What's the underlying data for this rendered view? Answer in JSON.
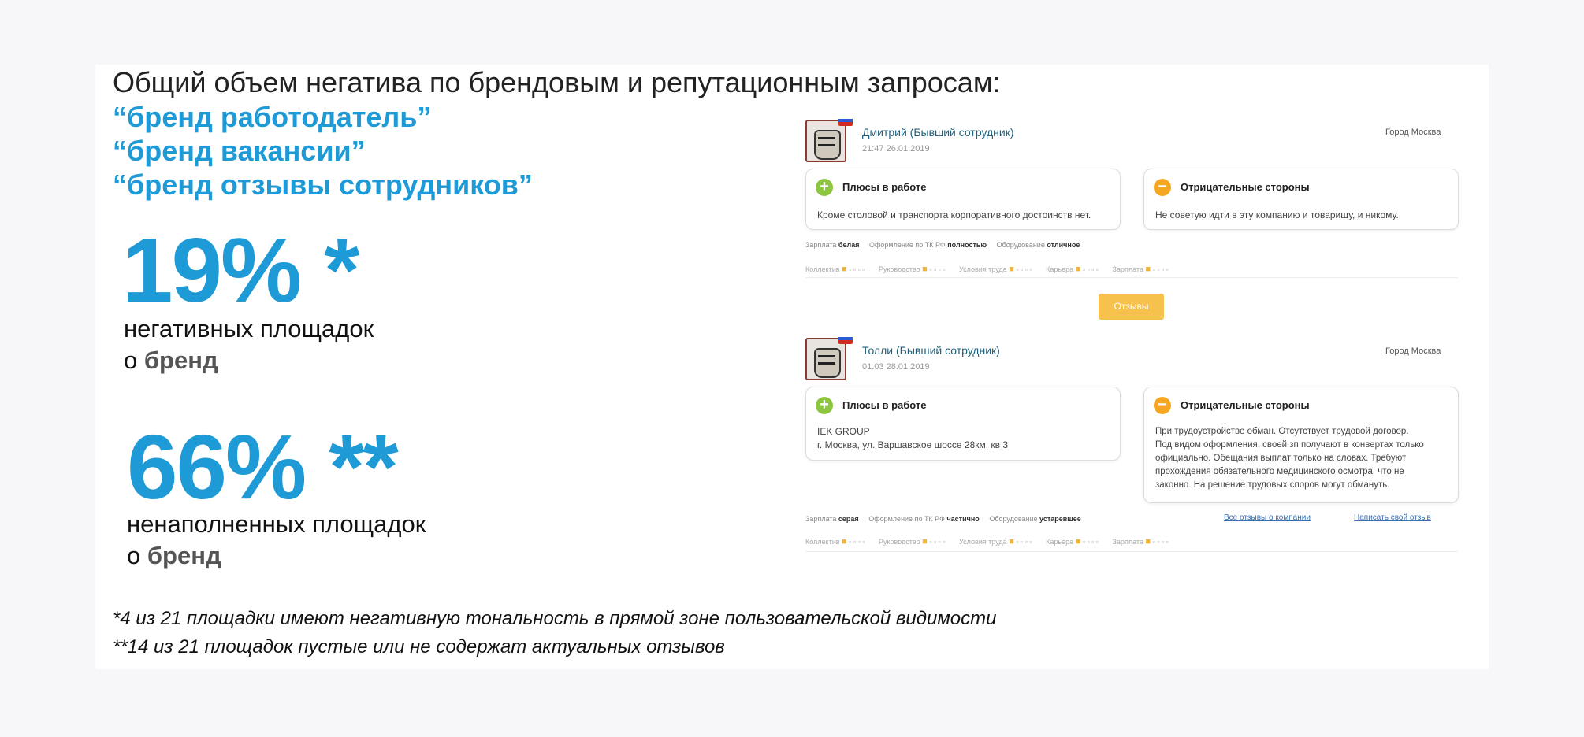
{
  "heading": "Общий объем негатива по брендовым и репутационным запросам:",
  "queries": [
    "“бренд работодатель”",
    "“бренд вакансии”",
    "“бренд отзывы сотрудников”"
  ],
  "stat1": {
    "value": "19% *",
    "line1": "негативных площадок",
    "prefix": "о",
    "brand": "бренд"
  },
  "stat2": {
    "value": "66% **",
    "line1": "ненаполненных площадок",
    "prefix": "о",
    "brand": "бренд"
  },
  "footnotes": [
    "*4 из 21 площадки имеют негативную тональность в прямой зоне пользовательской видимости",
    "**14 из 21 площадок пустые или не содержат актуальных отзывов"
  ],
  "colors": {
    "accent": "#1e9ad6",
    "plus": "#8cc63f",
    "minus": "#f5a623",
    "button": "#f6c24d"
  },
  "reviews": [
    {
      "author": "Дмитрий (Бывший сотрудник)",
      "date": "21:47 26.01.2019",
      "city": "Город Москва",
      "pros_title": "Плюсы в работе",
      "pros_text": [
        "Кроме столовой и транспорта корпоративного достоинств нет."
      ],
      "cons_title": "Отрицательные стороны",
      "cons_text": [
        "Не советую идти в эту компанию и товарищу, и никому."
      ],
      "meta": [
        [
          "Зарплата",
          "белая"
        ],
        [
          "Оформление по ТК РФ",
          "полностью"
        ],
        [
          "Оборудование",
          "отличное"
        ]
      ],
      "ratings": [
        "Коллектив",
        "Руководство",
        "Условия труда",
        "Карьера",
        "Зарплата"
      ]
    },
    {
      "author": "Толли (Бывший сотрудник)",
      "date": "01:03 28.01.2019",
      "city": "Город Москва",
      "pros_title": "Плюсы в работе",
      "pros_text": [
        "IEK GROUP",
        "г. Москва, ул. Варшавское шоссе 28км, кв 3"
      ],
      "cons_title": "Отрицательные стороны",
      "cons_text": [
        "При трудоустройстве обман. Отсутствует трудовой договор.",
        "Под видом оформления, своей зп получают в конвертах только",
        "официально. Обещания выплат только на словах. Требуют",
        "прохождения обязательного медицинского осмотра, что не",
        "законно. На решение трудовых споров могут обмануть."
      ],
      "meta": [
        [
          "Зарплата",
          "серая"
        ],
        [
          "Оформление по ТК РФ",
          "частично"
        ],
        [
          "Оборудование",
          "устаревшее"
        ]
      ],
      "ratings": [
        "Коллектив",
        "Руководство",
        "Условия труда",
        "Карьера",
        "Зарплата"
      ],
      "links": [
        "Все отзывы о компании",
        "Написать свой отзыв"
      ]
    }
  ],
  "more_button": "Отзывы",
  "pros_icon": "+",
  "cons_icon": "−"
}
